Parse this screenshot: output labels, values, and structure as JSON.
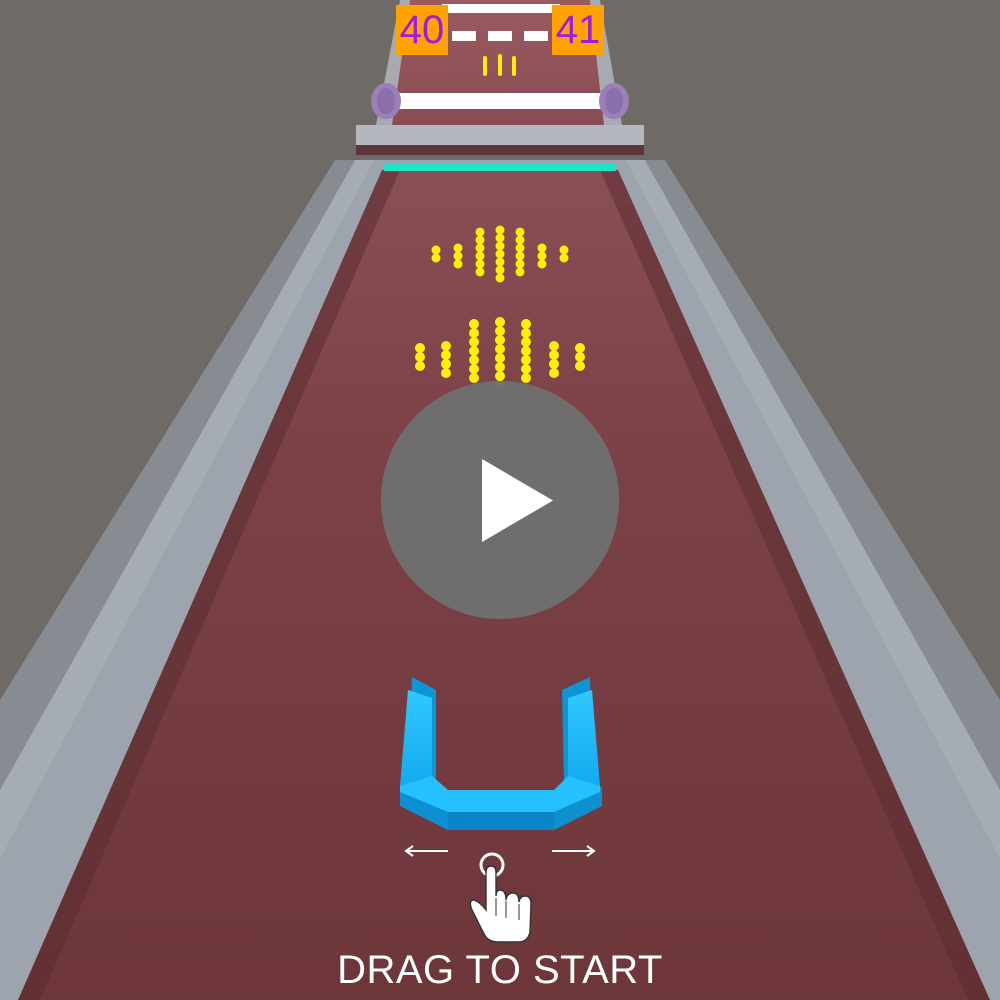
{
  "hud": {
    "current_level": "40",
    "next_level": "41"
  },
  "play_button": {
    "icon": "play-icon"
  },
  "instruction": {
    "label": "DRAG TO START",
    "icons": [
      "hand-pointer-icon",
      "arrow-left-icon",
      "arrow-right-icon"
    ]
  },
  "colors": {
    "background": "#6f6a66",
    "track": "#733a3f",
    "rails": "#9ea4ad",
    "balls": "#fff200",
    "collector": "#18b4f5",
    "finish_line": "#1ee3c4",
    "level_badge": "#ffa200",
    "level_text": "#9b1ee0"
  }
}
